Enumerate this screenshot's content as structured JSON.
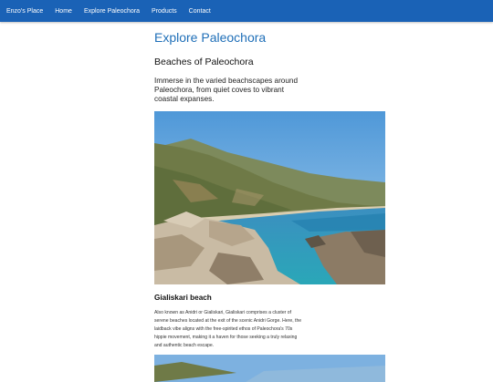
{
  "nav": {
    "brand": "Enzo's Place",
    "items": [
      "Home",
      "Explore Paleochora",
      "Products",
      "Contact"
    ]
  },
  "page": {
    "title": "Explore Paleochora",
    "section_title": "Beaches of Paleochora",
    "intro": "Immerse in the varied beachscapes around Paleochora, from quiet coves to vibrant coastal expanses."
  },
  "beaches": [
    {
      "name": "Gialiskari beach",
      "description": "Also known as Anidri or Gialiskari, Gialiskari comprises a cluster of serene beaches located at the exit of the scenic Anidri Gorge. Here, the laidback vibe aligns with the free-spirited ethos of Paleochora's 70s hippie movement, making it a haven for those seeking a truly relaxing and authentic beach escape."
    }
  ],
  "colors": {
    "navbar": "#1a62b6",
    "title": "#1f6fb8"
  }
}
